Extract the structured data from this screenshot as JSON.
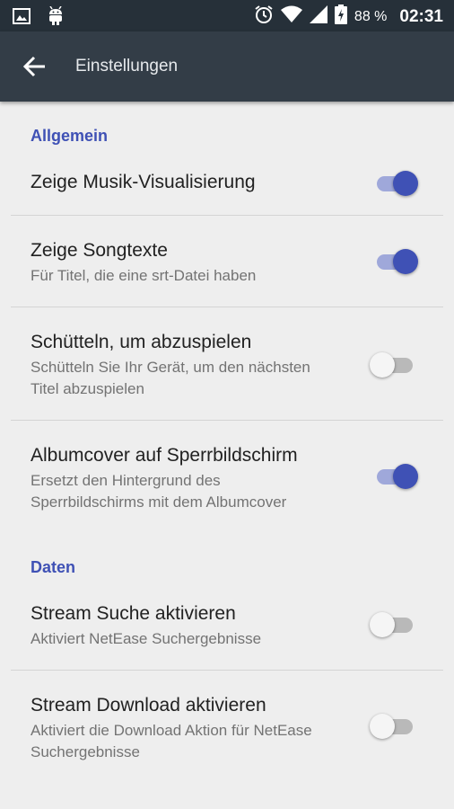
{
  "status_bar": {
    "icons_left": [
      "image-icon",
      "android-icon"
    ],
    "icons_right": [
      "alarm-icon",
      "wifi-icon",
      "signal-icon",
      "battery-charging-icon"
    ],
    "battery": "88 %",
    "time": "02:31"
  },
  "app_bar": {
    "back_icon": "arrow-back-icon",
    "title": "Einstellungen"
  },
  "sections": [
    {
      "header": "Allgemein",
      "items": [
        {
          "title": "Zeige Musik-Visualisierung",
          "summary": "",
          "enabled": true
        },
        {
          "title": "Zeige Songtexte",
          "summary": "Für Titel, die eine srt-Datei haben",
          "enabled": true
        },
        {
          "title": "Schütteln, um abzuspielen",
          "summary": "Schütteln Sie Ihr Gerät, um den nächsten Titel abzuspielen",
          "enabled": false
        },
        {
          "title": "Albumcover auf Sperrbildschirm",
          "summary": "Ersetzt den Hintergrund des Sperrbildschirms mit dem Albumcover",
          "enabled": true
        }
      ]
    },
    {
      "header": "Daten",
      "items": [
        {
          "title": "Stream Suche aktivieren",
          "summary": "Aktiviert NetEase Suchergebnisse",
          "enabled": false
        },
        {
          "title": "Stream Download aktivieren",
          "summary": "Aktiviert die Download Aktion für NetEase Suchergebnisse",
          "enabled": false
        }
      ]
    }
  ],
  "colors": {
    "accent": "#3f51b5",
    "accent_track": "#9fa8da",
    "status_bar": "#263039",
    "app_bar": "#333d47",
    "background": "#eeeeee"
  }
}
